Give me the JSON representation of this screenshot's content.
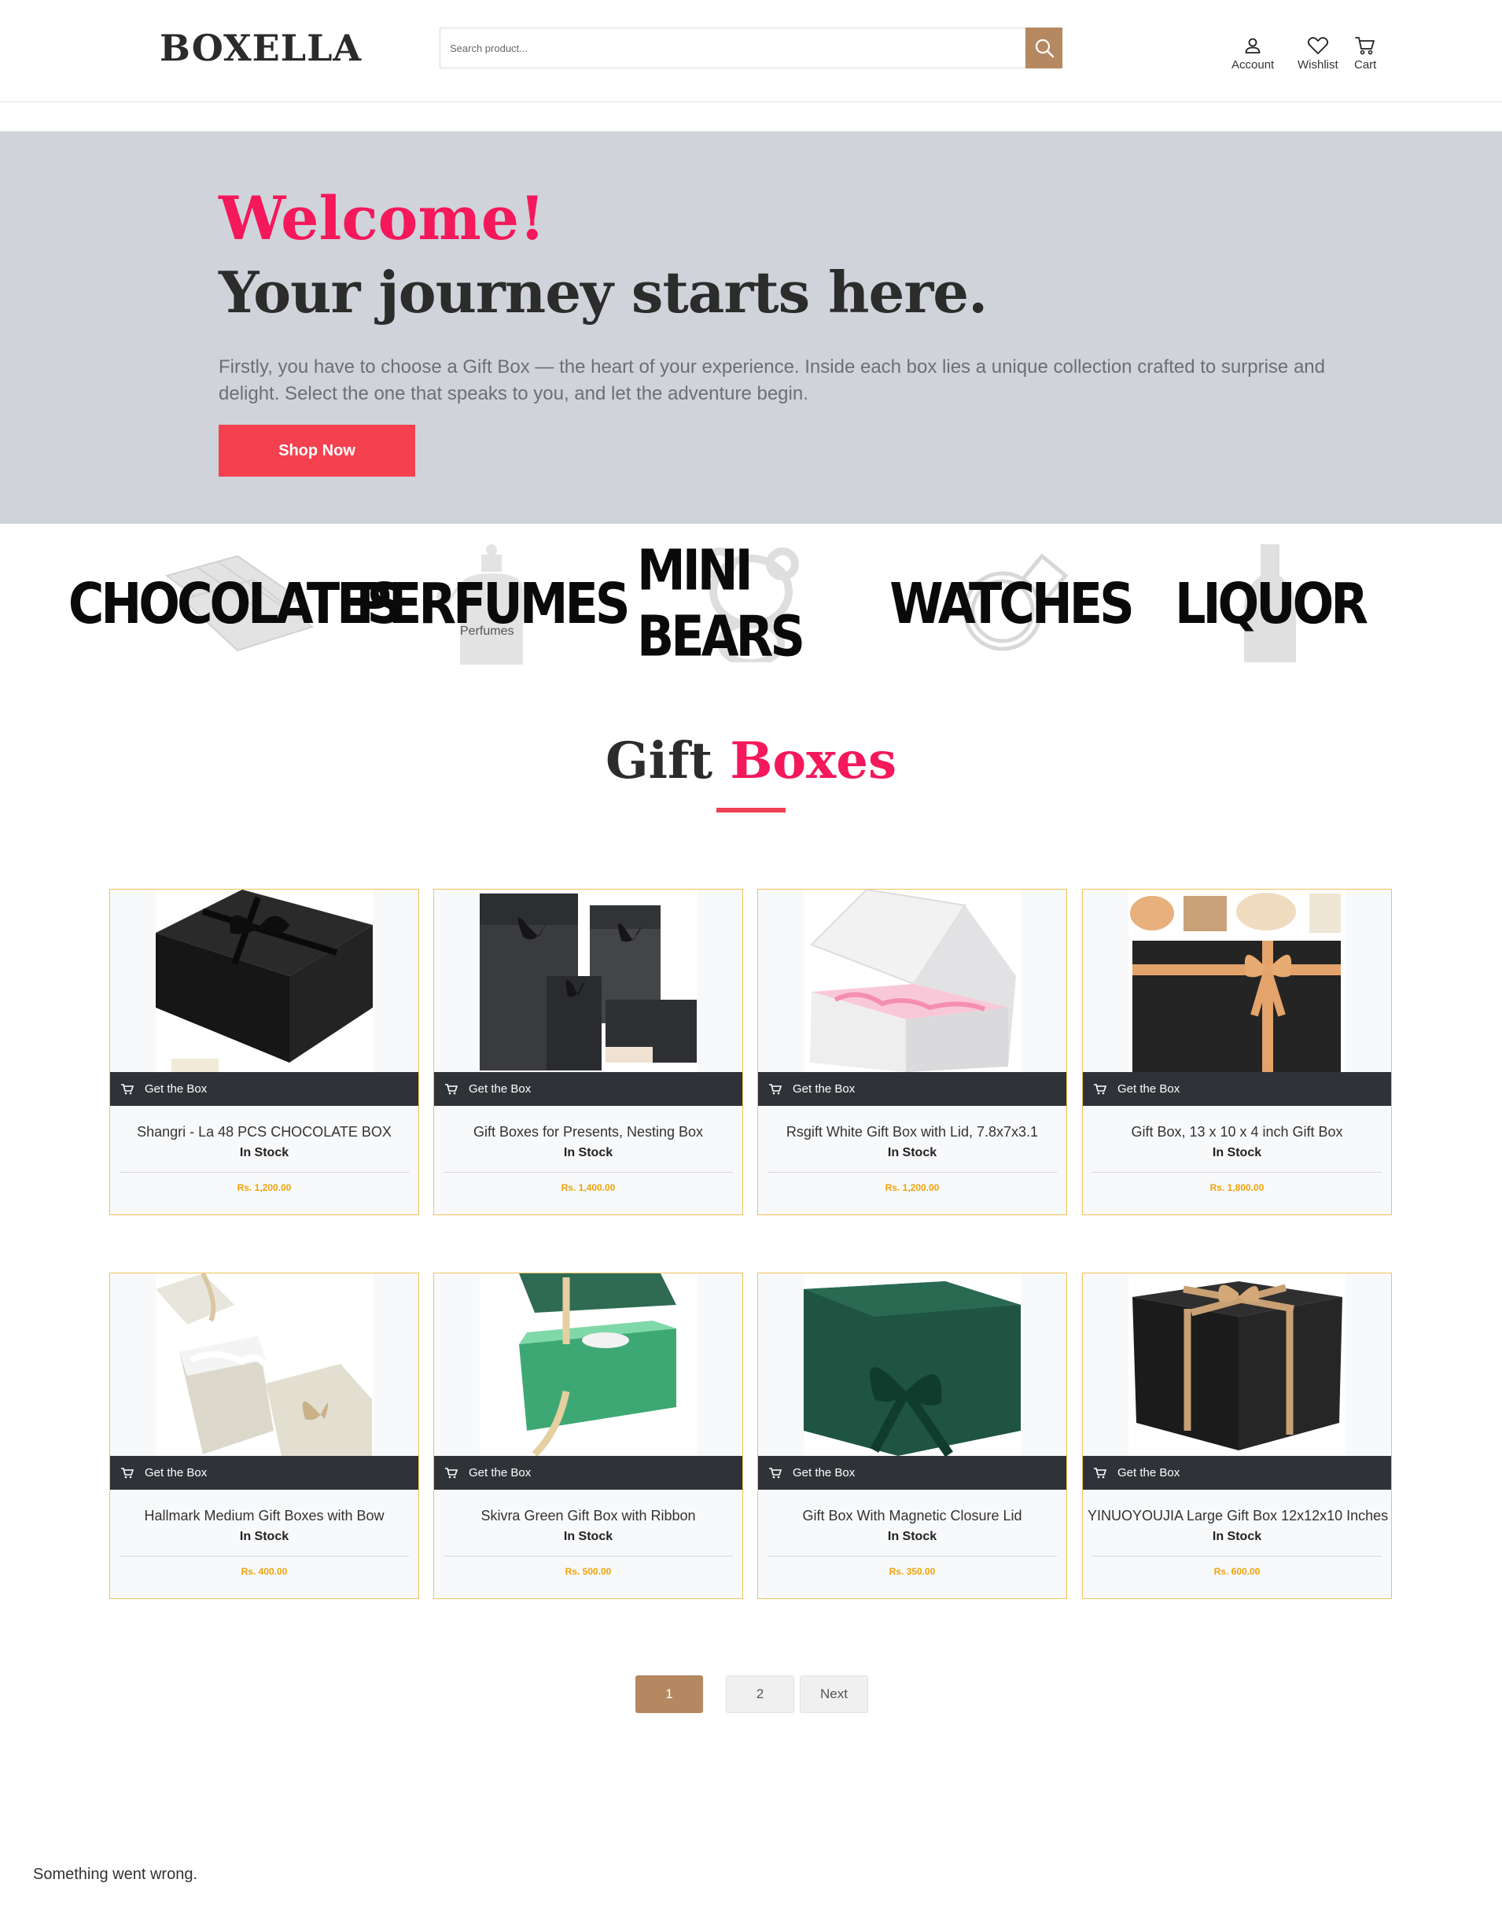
{
  "header": {
    "logo": "BOXELLA",
    "search_placeholder": "Search product...",
    "account_label": "Account",
    "wishlist_label": "Wishlist",
    "cart_label": "Cart"
  },
  "hero": {
    "welcome": "Welcome!",
    "title": "Your journey starts here.",
    "text": "Firstly, you have to choose a Gift Box — the heart of your experience. Inside each box lies a unique collection crafted to surprise and delight. Select the one that speaks to you, and let the adventure begin.",
    "button": "Shop Now"
  },
  "categories": [
    {
      "label": "CHOCOLATES"
    },
    {
      "label": "PERFUMES",
      "sub": "Perfumes"
    },
    {
      "label": "MINI BEARS"
    },
    {
      "label": "WATCHES"
    },
    {
      "label": "LIQUOR"
    }
  ],
  "section": {
    "title_part1": "Gift",
    "title_part2": "Boxes"
  },
  "product_action_label": "Get the Box",
  "products": [
    {
      "name": "Shangri - La 48 PCS CHOCOLATE BOX",
      "stock": "In Stock",
      "price": "Rs. 1,200.00"
    },
    {
      "name": "Gift Boxes for Presents, Nesting Box",
      "stock": "In Stock",
      "price": "Rs. 1,400.00"
    },
    {
      "name": "Rsgift White Gift Box with Lid, 7.8x7x3.1",
      "stock": "In Stock",
      "price": "Rs. 1,200.00"
    },
    {
      "name": "Gift Box, 13 x 10 x 4 inch Gift Box",
      "stock": "In Stock",
      "price": "Rs. 1,800.00"
    },
    {
      "name": "Hallmark Medium Gift Boxes with Bow",
      "stock": "In Stock",
      "price": "Rs. 400.00"
    },
    {
      "name": "Skivra Green Gift Box with Ribbon",
      "stock": "In Stock",
      "price": "Rs. 500.00"
    },
    {
      "name": "Gift Box With Magnetic Closure Lid",
      "stock": "In Stock",
      "price": "Rs. 350.00"
    },
    {
      "name": "YINUOYOUJIA Large Gift Box 12x12x10 Inches",
      "stock": "In Stock",
      "price": "Rs. 600.00"
    }
  ],
  "pagination": {
    "current": "1",
    "page2": "2",
    "next": "Next"
  },
  "error_message": "Something went wrong.",
  "colors": {
    "accent_pink": "#f5185b",
    "accent_red": "#f5414f",
    "accent_brown": "#b58862",
    "card_border": "#f0c25a",
    "price_gold": "#f0a20a",
    "card_bar": "#2f3338",
    "hero_bg": "#d0d4da"
  }
}
